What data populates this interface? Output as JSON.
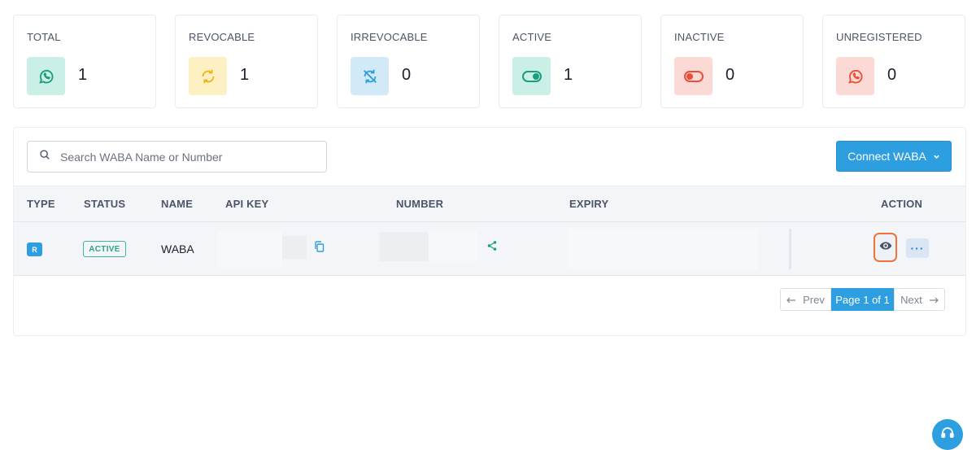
{
  "stats": [
    {
      "label": "TOTAL",
      "value": "1",
      "icon": "whatsapp-icon",
      "bg": "#c9efe6",
      "color": "#1a9f7e"
    },
    {
      "label": "REVOCABLE",
      "value": "1",
      "icon": "sync-icon",
      "bg": "#fdf0c2",
      "color": "#f5b114"
    },
    {
      "label": "IRREVOCABLE",
      "value": "0",
      "icon": "sync-disabled-icon",
      "bg": "#d2e9f8",
      "color": "#2d9ee0"
    },
    {
      "label": "ACTIVE",
      "value": "1",
      "icon": "toggle-on-icon",
      "bg": "#c9efe6",
      "color": "#1a9f7e"
    },
    {
      "label": "INACTIVE",
      "value": "0",
      "icon": "toggle-off-icon",
      "bg": "#fbd9d4",
      "color": "#ea4f3c"
    },
    {
      "label": "UNREGISTERED",
      "value": "0",
      "icon": "whatsapp-icon",
      "bg": "#fbd9d4",
      "color": "#ea4f3c"
    }
  ],
  "search": {
    "placeholder": "Search WABA Name or Number",
    "value": ""
  },
  "connect_button": {
    "label": "Connect WABA"
  },
  "table": {
    "columns": [
      "TYPE",
      "STATUS",
      "NAME",
      "API KEY",
      "NUMBER",
      "EXPIRY",
      "ACTION"
    ],
    "rows": [
      {
        "type": "R",
        "status": "ACTIVE",
        "name": "WABA"
      }
    ]
  },
  "pagination": {
    "prev": "Prev",
    "current": "Page 1 of 1",
    "next": "Next"
  },
  "colors": {
    "accent": "#2d9ee0",
    "active": "#2aa886",
    "highlight": "#f07238"
  }
}
